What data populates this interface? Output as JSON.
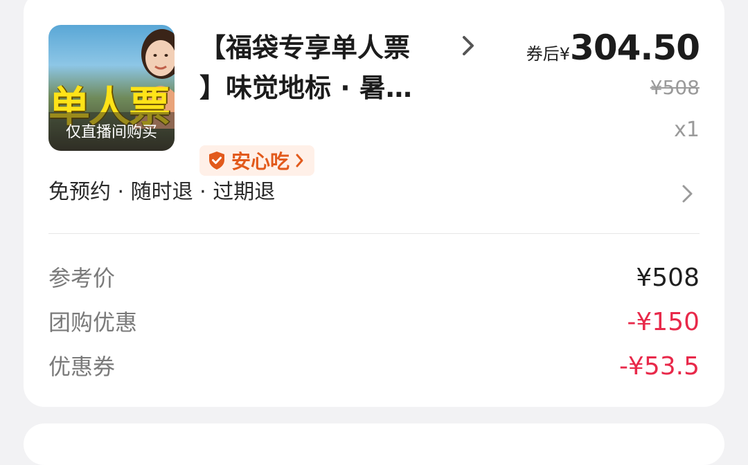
{
  "product": {
    "thumbnail": {
      "banner_text": "单人票",
      "strip_label": "仅直播间购买"
    },
    "title_line1": "【福袋专享单人票",
    "title_line2": "】味觉地标 · 暑…",
    "price": {
      "prefix": "券后¥",
      "value": "304.50",
      "original": "¥508",
      "quantity": "x1"
    },
    "badge": {
      "label": "安心吃",
      "icon": "shield-check-icon",
      "color": "#e25a1c"
    },
    "policy": "免预约 · 随时退 · 过期退"
  },
  "breakdown": [
    {
      "label": "参考价",
      "value": "¥508",
      "negative": false
    },
    {
      "label": "团购优惠",
      "value": "-¥150",
      "negative": true
    },
    {
      "label": "优惠券",
      "value": "-¥53.5",
      "negative": true
    }
  ],
  "colors": {
    "accent_red": "#e8294a",
    "badge_orange": "#e25a1c",
    "badge_bg": "#fff0e8"
  }
}
